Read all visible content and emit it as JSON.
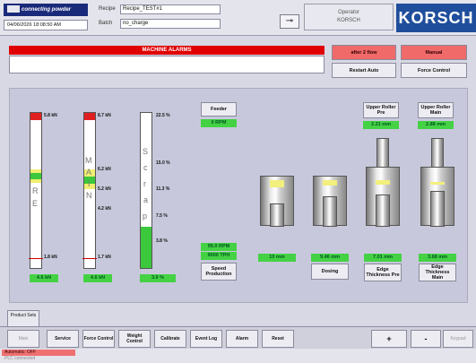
{
  "header": {
    "logo_text": "connecting powder",
    "datetime": "04/06/2026 18:08:50 AM",
    "recipe_label": "Recipe",
    "recipe_value": "Recipe_TEST#1",
    "batch_label": "Batch",
    "batch_value": "no_charge",
    "key_icon": "key-icon",
    "operator_label": "Operator",
    "operator_value": "KORSCH",
    "brand": "KORSCH"
  },
  "alarms": {
    "title": "MACHINE ALARMS",
    "message": "",
    "buttons": {
      "after_flow": "after 2 flow",
      "manual": "Manual",
      "restart_auto": "Restart Auto",
      "force_control": "Force Control"
    }
  },
  "gauges": {
    "force_pre": {
      "top_label": "5.8 kN",
      "bottom_label": "1.8 kN",
      "value": "4.6 kN",
      "letters": [
        "R",
        "E"
      ]
    },
    "force_main": {
      "top_label": "8.7 kN",
      "upper_label": "6.2 kN",
      "mid_label": "5.2 kN",
      "lower_label": "4.2 kN",
      "bottom_label": "1.7 kN",
      "value": "4.6 kN",
      "letters": [
        "M",
        "A",
        "I",
        "N"
      ]
    },
    "scrap": {
      "ticks": [
        "22.5 %",
        "15.0 %",
        "11.3 %",
        "7.5 %",
        "3.8 %"
      ],
      "value": "3.9 %",
      "fill_percent": 3.9,
      "max_percent": 22.5,
      "letters": [
        "S",
        "c",
        "r",
        "a",
        "p"
      ]
    }
  },
  "feeder": {
    "button": "Feeder",
    "value": "0 RPM"
  },
  "upper_roller_pre": {
    "button": "Upper Roller Pre",
    "value": "2.21 mm"
  },
  "upper_roller_main": {
    "button": "Upper Roller Main",
    "value": "2.88 mm"
  },
  "speed": {
    "rpm_value": "95.0 RPM",
    "tph_value": "9000 TPH",
    "button": "Speed Production"
  },
  "bottom_values": {
    "fill": "10 mm",
    "dosing_value": "9.46 mm",
    "dosing_button": "Dosing",
    "edge_pre_value": "7.01 mm",
    "edge_pre_button": "Edge Thickness Pre",
    "edge_main_value": "3.68 mm",
    "edge_main_button": "Edge Thickness Main"
  },
  "tabs": {
    "product_sets": "Product Sets"
  },
  "function_keys": {
    "main": "Main",
    "service": "Service",
    "force_control": "Force Control",
    "weight_control": "Weight Control",
    "calibrate": "Calibrate",
    "event_log": "Event Log",
    "alarm": "Alarm",
    "reset": "Reset",
    "plus": "+",
    "minus": "-",
    "keypad": "Keypad"
  },
  "status": {
    "line1": "Automatic: OFF",
    "line2": "PLC connected"
  }
}
